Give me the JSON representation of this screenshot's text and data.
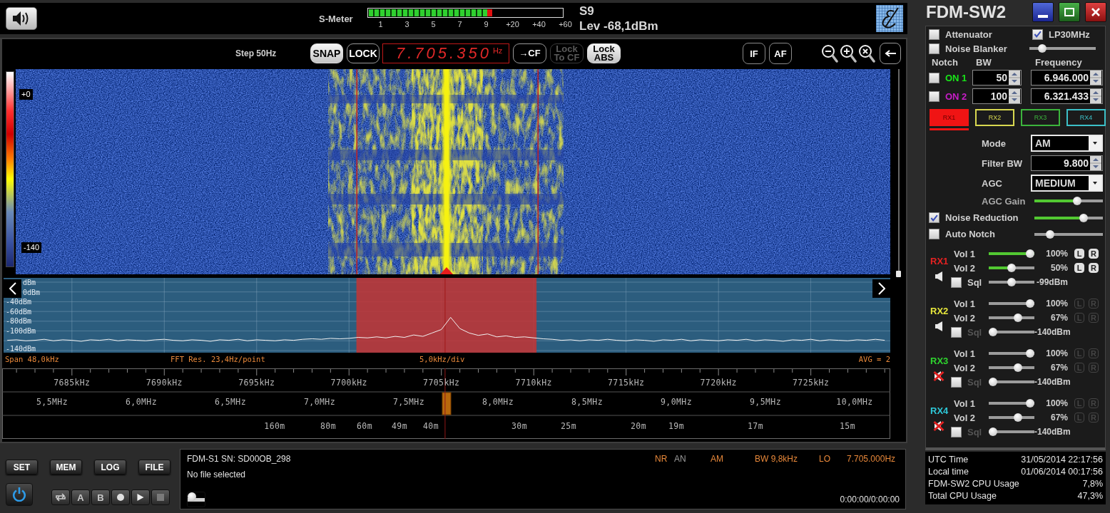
{
  "top_bar": {
    "s_meter": {
      "label": "S-Meter",
      "level": 0.64,
      "scale": [
        "1",
        "3",
        "5",
        "7",
        "9",
        "+20",
        "+40",
        "+60"
      ]
    },
    "s_reading": "S9",
    "level_reading": "Lev -68,1dBm"
  },
  "toolbar": {
    "step": "Step 50Hz",
    "tuning_buttons": [
      {
        "label": "SNAP",
        "on": true,
        "disabled": false
      },
      {
        "label": "LOCK",
        "on": false,
        "disabled": false
      }
    ],
    "frequency": {
      "value": "7.705.350",
      "unit": "Hz"
    },
    "lock_buttons": [
      {
        "label": "→CF",
        "on": false,
        "disabled": false
      },
      {
        "label": "Lock To CF",
        "on": false,
        "disabled": true
      },
      {
        "label": "Lock ABS",
        "on": true,
        "disabled": false
      }
    ],
    "view_buttons": [
      {
        "label": "IF"
      },
      {
        "label": "AF"
      }
    ]
  },
  "waterfall": {
    "scale_labels": [
      "+0",
      "-140"
    ]
  },
  "spectrum": {
    "cut_labels": [
      "dBm",
      "0dBm"
    ],
    "chart_data": {
      "type": "line",
      "grid": true,
      "xlim": [
        7681.3,
        7729.3
      ],
      "ylim": [
        -140,
        0
      ],
      "xticks": [
        {
          "value": 7685,
          "label": "7685kHz"
        },
        {
          "value": 7690,
          "label": "7690kHz"
        },
        {
          "value": 7695,
          "label": "7695kHz"
        },
        {
          "value": 7700,
          "label": "7700kHz"
        },
        {
          "value": 7705,
          "label": "7705kHz"
        },
        {
          "value": 7710,
          "label": "7710kHz"
        },
        {
          "value": 7715,
          "label": "7715kHz"
        },
        {
          "value": 7720,
          "label": "7720kHz"
        },
        {
          "value": 7725,
          "label": "7725kHz"
        }
      ],
      "yticks": [
        {
          "value": -40,
          "label": "-40dBm"
        },
        {
          "value": -60,
          "label": "-60dBm"
        },
        {
          "value": -80,
          "label": "-80dBm"
        },
        {
          "value": -100,
          "label": "-100dBm"
        },
        {
          "value": -140,
          "label": "-140dBm"
        }
      ],
      "bands": [
        {
          "axis": "x",
          "from": 7700.4,
          "to": 7710.15,
          "color": "#c43434"
        }
      ],
      "ref_lines": [
        {
          "axis": "x",
          "value": 7705.2,
          "color": "#a01818"
        }
      ],
      "x": [
        7681.5,
        7682,
        7682.5,
        7683,
        7683.5,
        7684,
        7684.5,
        7685,
        7685.5,
        7686,
        7686.5,
        7687,
        7687.5,
        7688,
        7688.5,
        7689,
        7689.5,
        7690,
        7690.5,
        7691,
        7691.5,
        7692,
        7692.5,
        7693,
        7693.5,
        7694,
        7694.5,
        7695,
        7695.5,
        7696,
        7696.5,
        7697,
        7697.5,
        7698,
        7698.5,
        7699,
        7699.5,
        7700,
        7700.5,
        7701,
        7701.5,
        7702,
        7702.5,
        7703,
        7703.5,
        7704,
        7704.5,
        7705,
        7705.5,
        7706,
        7706.5,
        7707,
        7707.5,
        7708,
        7708.5,
        7709,
        7709.5,
        7710,
        7710.5,
        7711,
        7711.5,
        7712,
        7712.5,
        7713,
        7713.5,
        7714,
        7714.5,
        7715,
        7715.5,
        7716,
        7716.5,
        7717,
        7717.5,
        7718,
        7718.5,
        7719,
        7719.5,
        7720,
        7720.5,
        7721,
        7721.5,
        7722,
        7722.5,
        7723,
        7723.5,
        7724,
        7724.5,
        7725,
        7725.5,
        7726,
        7726.5,
        7727,
        7727.5,
        7728,
        7728.5,
        7729
      ],
      "series": [
        {
          "color": "#f2f2f2",
          "values": [
            -119,
            -118,
            -120,
            -119,
            -117,
            -120,
            -118,
            -119,
            -121,
            -118,
            -119,
            -117,
            -120,
            -118,
            -119,
            -120,
            -118,
            -117,
            -119,
            -120,
            -118,
            -119,
            -121,
            -118,
            -119,
            -117,
            -120,
            -118,
            -119,
            -120,
            -118,
            -119,
            -117,
            -116,
            -117,
            -115,
            -116,
            -115,
            -113,
            -114,
            -112,
            -114,
            -111,
            -113,
            -108,
            -111,
            -104,
            -97,
            -72,
            -95,
            -104,
            -109,
            -106,
            -112,
            -110,
            -113,
            -112,
            -114,
            -116,
            -117,
            -119,
            -118,
            -120,
            -118,
            -119,
            -117,
            -119,
            -120,
            -118,
            -119,
            -121,
            -118,
            -119,
            -117,
            -120,
            -118,
            -119,
            -120,
            -118,
            -119,
            -117,
            -120,
            -118,
            -119,
            -121,
            -118,
            -119,
            -117,
            -120,
            -118,
            -119,
            -120,
            -118,
            -119,
            -117,
            -119
          ]
        }
      ]
    },
    "info": [
      "Span 48,0kHz",
      "FFT Res. 23,4Hz/point",
      "5,0kHz/div",
      "AVG = 2"
    ]
  },
  "scales": {
    "mhz": [
      "5,5MHz",
      "6,0MHz",
      "6,5MHz",
      "7,0MHz",
      "7,5MHz",
      "8,0MHz",
      "8,5MHz",
      "9,0MHz",
      "9,5MHz",
      "10,0MHz"
    ],
    "bands": [
      "160m",
      "80m",
      "60m",
      "49m",
      "40m",
      "30m",
      "25m",
      "20m",
      "19m",
      "17m",
      "15m"
    ]
  },
  "bottom": {
    "buttons": [
      "SET",
      "MEM",
      "LOG",
      "FILE"
    ],
    "player": [
      {
        "kind": "loop"
      },
      {
        "kind": "key",
        "label": "A"
      },
      {
        "kind": "key",
        "label": "B"
      },
      {
        "kind": "record"
      },
      {
        "kind": "play"
      },
      {
        "kind": "stop"
      }
    ]
  },
  "status": {
    "device": "FDM-S1 SN: SD00OB_298",
    "file": "No file selected",
    "indicators": [
      {
        "text": "NR",
        "on": true
      },
      {
        "text": "AN",
        "on": false
      },
      {
        "text": "AM",
        "on": true
      },
      {
        "text": "BW 9,8kHz",
        "on": true
      },
      {
        "text": "LO",
        "on": true
      },
      {
        "text": "7.705.000Hz",
        "on": true
      }
    ],
    "playback": {
      "level": 0,
      "time": "0:00:00/0:00:00"
    }
  },
  "panel": {
    "title": "FDM-SW2",
    "options": [
      {
        "label": "Attenuator",
        "checked": false
      },
      {
        "label": "LP30MHz",
        "checked": true
      }
    ],
    "noise_blanker": {
      "label": "Noise Blanker",
      "checked": false,
      "level": 0.15
    },
    "notch": {
      "headers": [
        "Notch",
        "BW",
        "Frequency"
      ],
      "rows": [
        {
          "label": "ON 1",
          "color": "#19e619",
          "checked": false,
          "bw": "50",
          "frequency": "6.946.000"
        },
        {
          "label": "ON 2",
          "color": "#c81ec8",
          "checked": false,
          "bw": "100",
          "frequency": "6.321.433"
        }
      ]
    },
    "rx_tabs": [
      {
        "label": "RX1",
        "color": "#f01414",
        "selected": true
      },
      {
        "label": "RX2",
        "color": "#d8d850",
        "selected": false
      },
      {
        "label": "RX3",
        "color": "#3cb43c",
        "selected": false
      },
      {
        "label": "RX4",
        "color": "#3cc0c8",
        "selected": false
      }
    ],
    "settings": [
      {
        "kind": "dropdown",
        "label": "Mode",
        "value": "AM"
      },
      {
        "kind": "spin",
        "label": "Filter BW",
        "value": "9.800"
      },
      {
        "kind": "dropdown",
        "label": "AGC",
        "value": "MEDIUM"
      },
      {
        "kind": "slider",
        "label": "AGC Gain",
        "level": 0.64,
        "active": true
      },
      {
        "kind": "check_slider",
        "label": "Noise Reduction",
        "checked": true,
        "level": 0.75
      },
      {
        "kind": "check_slider",
        "label": "Auto Notch",
        "checked": false,
        "level": 0.19
      }
    ],
    "receivers": [
      {
        "label": "RX1",
        "color": "#e52222",
        "muted": false,
        "active": true,
        "volumes": [
          {
            "label": "Vol 1",
            "level": 1,
            "reading": "100%",
            "channels": [
              "L",
              "R"
            ]
          },
          {
            "label": "Vol 2",
            "level": 0.5,
            "reading": "50%",
            "channels": [
              "L",
              "R"
            ]
          }
        ],
        "squelch": {
          "label": "Sql",
          "checked": false,
          "level": 0.5,
          "reading": "-99dBm"
        }
      },
      {
        "label": "RX2",
        "color": "#e6e63c",
        "muted": false,
        "active": false,
        "volumes": [
          {
            "label": "Vol 1",
            "level": 1,
            "reading": "100%",
            "channels": [
              "L",
              "R"
            ]
          },
          {
            "label": "Vol 2",
            "level": 0.67,
            "reading": "67%",
            "channels": [
              "L",
              "R"
            ]
          }
        ],
        "squelch": {
          "label": "Sql",
          "checked": false,
          "level": 0,
          "reading": "-140dBm"
        }
      },
      {
        "label": "RX3",
        "color": "#2ed42e",
        "muted": true,
        "active": false,
        "volumes": [
          {
            "label": "Vol 1",
            "level": 1,
            "reading": "100%",
            "channels": [
              "L",
              "R"
            ]
          },
          {
            "label": "Vol 2",
            "level": 0.67,
            "reading": "67%",
            "channels": [
              "L",
              "R"
            ]
          }
        ],
        "squelch": {
          "label": "Sql",
          "checked": false,
          "level": 0,
          "reading": "-140dBm"
        }
      },
      {
        "label": "RX4",
        "color": "#2ec8d8",
        "muted": true,
        "active": false,
        "volumes": [
          {
            "label": "Vol 1",
            "level": 1,
            "reading": "100%",
            "channels": [
              "L",
              "R"
            ]
          },
          {
            "label": "Vol 2",
            "level": 0.67,
            "reading": "67%",
            "channels": [
              "L",
              "R"
            ]
          }
        ],
        "squelch": {
          "label": "Sql",
          "checked": false,
          "level": 0,
          "reading": "-140dBm"
        }
      }
    ],
    "system_info": [
      {
        "label": "UTC Time",
        "value": "31/05/2014 22:17:56"
      },
      {
        "label": "Local time",
        "value": "01/06/2014 00:17:56"
      },
      {
        "label": "FDM-SW2 CPU Usage",
        "value": "7,8%"
      },
      {
        "label": "Total CPU Usage",
        "value": "47,3%"
      }
    ]
  }
}
